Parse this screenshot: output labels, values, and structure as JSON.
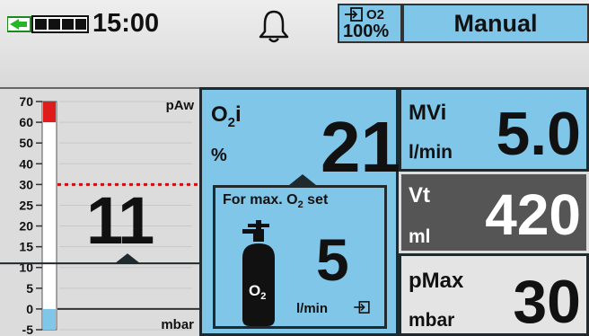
{
  "status_bar": {
    "time": "15:00",
    "o2_source_label": "O2",
    "o2_source_percent": "100%",
    "mode": "Manual",
    "battery_level": 1.0,
    "icons": [
      "battery-icon",
      "bell-icon",
      "o2-source-icon"
    ]
  },
  "pressure_gauge": {
    "unit_top": "pAw",
    "unit_bottom": "mbar",
    "value": "11",
    "ticks": [
      "70",
      "60",
      "50",
      "40",
      "30",
      "25",
      "20",
      "15",
      "10",
      "5",
      "0",
      "-5"
    ],
    "limit_line": 30,
    "marker": 11,
    "colors": {
      "high": "#e01b1b",
      "low": "#7fc6e8",
      "limit": "#d01010"
    }
  },
  "o2_panel": {
    "title": "O",
    "title_sub": "2",
    "title_suffix": "i",
    "unit": "%",
    "value": "21",
    "flow_title": "For max. O",
    "flow_title_sub": "2",
    "flow_title_suffix": " set",
    "cylinder_label": "O",
    "cylinder_label_sub": "2",
    "flow_value": "5",
    "flow_unit": "l/min"
  },
  "tiles": [
    {
      "label": "MVi",
      "unit": "l/min",
      "value": "5.0"
    },
    {
      "label": "Vt",
      "unit": "ml",
      "value": "420"
    },
    {
      "label": "pMax",
      "unit": "mbar",
      "value": "30"
    }
  ],
  "colors": {
    "accent": "#7fc6e8",
    "dark": "#1f2a2f",
    "tile_dark": "#555555"
  }
}
